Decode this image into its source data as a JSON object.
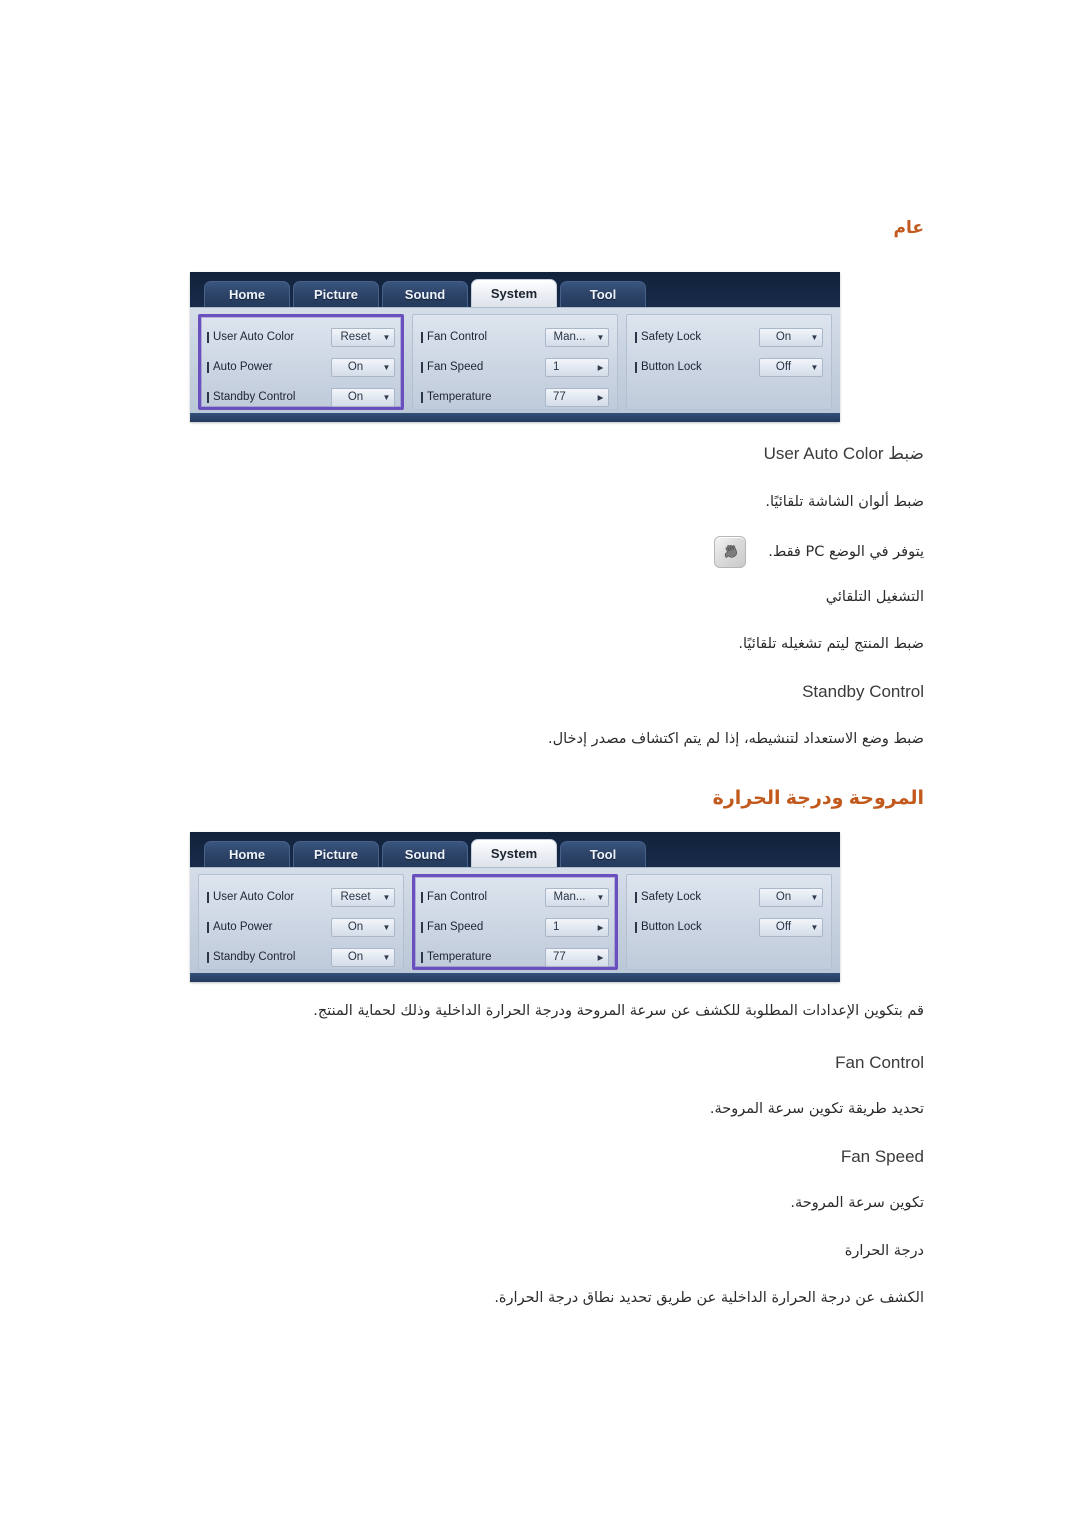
{
  "headings": {
    "general": "عام",
    "fan_temperature": "المروحة ودرجة الحرارة"
  },
  "osd": {
    "tabs": [
      {
        "label": "Home",
        "active": false
      },
      {
        "label": "Picture",
        "active": false
      },
      {
        "label": "Sound",
        "active": false
      },
      {
        "label": "System",
        "active": true
      },
      {
        "label": "Tool",
        "active": false
      }
    ],
    "columns": [
      {
        "id": "general",
        "rows": [
          {
            "label": "User Auto Color",
            "value": "Reset",
            "control": "dropdown"
          },
          {
            "label": "Auto Power",
            "value": "On",
            "control": "dropdown"
          },
          {
            "label": "Standby Control",
            "value": "On",
            "control": "dropdown"
          }
        ]
      },
      {
        "id": "fan",
        "rows": [
          {
            "label": "Fan Control",
            "value": "Man...",
            "control": "dropdown"
          },
          {
            "label": "Fan Speed",
            "value": "1",
            "control": "stepper"
          },
          {
            "label": "Temperature",
            "value": "77",
            "control": "stepper"
          }
        ]
      },
      {
        "id": "lock",
        "rows": [
          {
            "label": "Safety Lock",
            "value": "On",
            "control": "dropdown"
          },
          {
            "label": "Button Lock",
            "value": "Off",
            "control": "dropdown"
          }
        ]
      }
    ],
    "selected_column_first": "general",
    "selected_column_second": "fan"
  },
  "general_section": {
    "user_auto_color_title": "ضبط User Auto Color",
    "user_auto_color_desc": "ضبط ألوان الشاشة تلقائيًا.",
    "note_text": "يتوفر في الوضع PC فقط.",
    "note_icon": "note-hand-icon",
    "auto_power_title": "التشغيل التلقائي",
    "auto_power_desc": "ضبط المنتج ليتم تشغيله تلقائيًا.",
    "standby_control_title": "Standby Control",
    "standby_control_desc": "ضبط وضع الاستعداد لتنشيطه، إذا لم يتم اكتشاف مصدر إدخال."
  },
  "fan_section": {
    "intro": "قم بتكوين الإعدادات المطلوبة للكشف عن سرعة المروحة ودرجة الحرارة الداخلية وذلك لحماية المنتج.",
    "fan_control_title": "Fan Control",
    "fan_control_desc": "تحديد طريقة تكوين سرعة المروحة.",
    "fan_speed_title": "Fan Speed",
    "fan_speed_desc": "تكوين سرعة المروحة.",
    "temperature_title": "درجة الحرارة",
    "temperature_desc": "الكشف عن درجة الحرارة الداخلية عن طريق تحديد نطاق درجة الحرارة."
  },
  "colors": {
    "heading_orange": "#c25a1e",
    "selection_purple": "#6a4fbe",
    "osd_dark_blue": "#1b3050",
    "body_text": "#2b2b2b"
  }
}
